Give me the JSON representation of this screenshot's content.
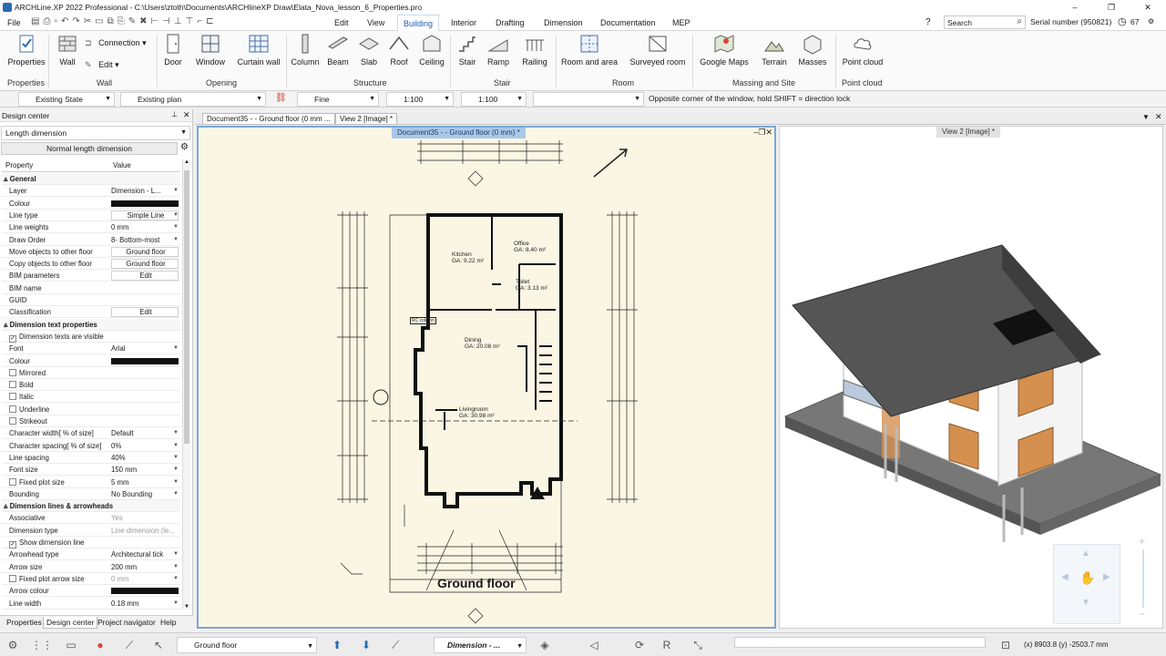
{
  "title": "ARCHLine.XP 2022 Professional - C:\\Users\\ztoth\\Documents\\ARCHlineXP Draw\\Elata_Nova_lesson_6_Properties.pro",
  "menu": [
    "File",
    "Edit",
    "View",
    "Building",
    "Interior",
    "Drafting",
    "Dimension",
    "Documentation",
    "MEP"
  ],
  "menu_active": "Building",
  "search_placeholder": "Search",
  "serial": "Serial number (950821)",
  "notif_count": "67",
  "ribbon": {
    "properties": "Properties",
    "wall": "Wall",
    "connection": "Connection",
    "edit": "Edit",
    "door": "Door",
    "window": "Window",
    "curtain_wall": "Curtain wall",
    "column": "Column",
    "beam": "Beam",
    "slab": "Slab",
    "roof": "Roof",
    "ceiling": "Ceiling",
    "stair": "Stair",
    "ramp": "Ramp",
    "railing": "Railing",
    "room_area": "Room and area",
    "surveyed_room": "Surveyed room",
    "google_maps": "Google Maps",
    "terrain": "Terrain",
    "masses": "Masses",
    "point_cloud": "Point cloud",
    "groups": [
      "Properties",
      "Wall",
      "Opening",
      "Structure",
      "Stair",
      "Room",
      "Massing and Site",
      "Point cloud"
    ]
  },
  "toolbar2": {
    "state": "Existing State",
    "plan": "Existing plan",
    "quality": "Fine",
    "scale1": "1:100",
    "scale2": "1:100",
    "hint": "Opposite corner of the window, hold SHIFT = direction lock"
  },
  "panel": {
    "title": "Design center",
    "dropdown": "Length dimension",
    "subtitle": "Normal length dimension",
    "col_property": "Property",
    "col_value": "Value",
    "rows": [
      {
        "t": "sec",
        "k": "General"
      },
      {
        "k": "Layer",
        "v": "Dimension - L...",
        "dd": true
      },
      {
        "k": "Colour",
        "v": "",
        "swatch": true
      },
      {
        "k": "Line type",
        "v": "Simple Line",
        "dd": true,
        "c": true
      },
      {
        "k": "Line weights",
        "v": "0 mm",
        "dd": true
      },
      {
        "k": "Draw Order",
        "v": "8- Bottom-most",
        "dd": true
      },
      {
        "k": "Move objects to other floor",
        "v": "Ground floor",
        "c": true
      },
      {
        "k": "Copy objects to other floor",
        "v": "Ground floor",
        "c": true
      },
      {
        "k": "BIM parameters",
        "v": "Edit",
        "c": true
      },
      {
        "k": "BIM name",
        "v": ""
      },
      {
        "k": "GUID",
        "v": ""
      },
      {
        "k": "Classification",
        "v": "Edit",
        "c": true
      },
      {
        "t": "sec",
        "k": "Dimension text properties"
      },
      {
        "k": "Dimension texts are visible",
        "cb": true,
        "checked": true
      },
      {
        "k": "Font",
        "v": "Arial",
        "dd": true
      },
      {
        "k": "Colour",
        "v": "",
        "swatch": true
      },
      {
        "k": "Mirrored",
        "cb": true
      },
      {
        "k": "Bold",
        "cb": true
      },
      {
        "k": "Italic",
        "cb": true
      },
      {
        "k": "Underline",
        "cb": true
      },
      {
        "k": "Strikeout",
        "cb": true
      },
      {
        "k": "Character width[ % of size]",
        "v": "Default",
        "dd": true
      },
      {
        "k": "Character spacing[ % of size]",
        "v": "0%",
        "dd": true
      },
      {
        "k": "Line spacing",
        "v": "40%",
        "dd": true
      },
      {
        "k": "Font size",
        "v": "150 mm",
        "dd": true
      },
      {
        "k": "Fixed plot size",
        "v": "5 mm",
        "cb": true,
        "dd": true
      },
      {
        "k": "Bounding",
        "v": "No Bounding",
        "dd": true
      },
      {
        "t": "sec",
        "k": "Dimension lines & arrowheads"
      },
      {
        "k": "Associative",
        "v": "Yes",
        "gray": true
      },
      {
        "k": "Dimension type",
        "v": "Line dimension (le...",
        "gray": true
      },
      {
        "k": "Show dimension line",
        "cb": true,
        "checked": true
      },
      {
        "k": "Arrowhead type",
        "v": "Architectural tick",
        "dd": true
      },
      {
        "k": "Arrow size",
        "v": "200 mm",
        "dd": true
      },
      {
        "k": "Fixed plot arrow size",
        "v": "0 mm",
        "cb": true,
        "gray": true,
        "dd": true
      },
      {
        "k": "Arrow colour",
        "v": "",
        "swatch": true
      },
      {
        "k": "Line width",
        "v": "0.18 mm",
        "dd": true
      }
    ],
    "tabs": [
      "Properties",
      "Design center",
      "Project navigator",
      "Help"
    ]
  },
  "doctabs": [
    "Document35 -  - Ground floor (0 mm ...",
    "View 2 [Image] *"
  ],
  "view1_title": "Document35 -  - Ground floor (0 mm) *",
  "view2_title": "View 2 [Image] *",
  "plan": {
    "rooms": [
      {
        "name": "Kitchen",
        "area": "GA: 9.22 m²"
      },
      {
        "name": "Office",
        "area": "GA: 8.40 m²"
      },
      {
        "name": "Toilet",
        "area": "GA: 3.13 m²"
      },
      {
        "name": "Dining",
        "area": "GA: 20.08 m²"
      },
      {
        "name": "Livingroom",
        "area": "GA: 30.98 m²"
      }
    ],
    "floor_label": "Ground floor",
    "rc_label": "RC column"
  },
  "status": {
    "floor": "Ground floor",
    "layer": "Dimension - ...",
    "coords": "(x) 8903.8  (y) -2503.7 mm"
  }
}
